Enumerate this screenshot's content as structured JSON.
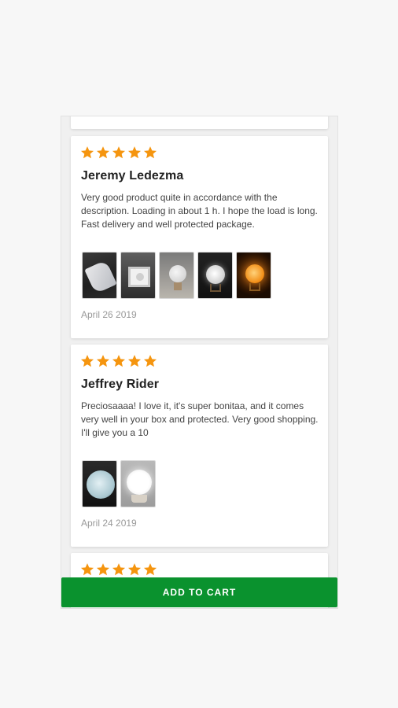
{
  "colors": {
    "star": "#f5950f",
    "cart_button": "#0a922e"
  },
  "reviews": [
    {
      "rating": 5,
      "name": "Jeremy Ledezma",
      "text": "Very good product quite in accordance with the description. Loading in about 1 h. I hope the load is long. Fast delivery and well protected package.",
      "date": "April 26 2019",
      "photos": [
        "wrapped-lamp-photo",
        "lamp-in-box-photo",
        "lamp-unlit-photo",
        "lamp-white-glow-photo",
        "lamp-orange-glow-photo"
      ]
    },
    {
      "rating": 5,
      "name": "Jeffrey Rider",
      "text": "Preciosaaaa! I love it, it's super bonitaa, and it comes very well in your box and protected. Very good shopping. I'll give you a 10",
      "date": "April 24 2019",
      "photos": [
        "moon-lamp-blue-photo",
        "moon-lamp-bright-photo"
      ]
    },
    {
      "rating": 5
    }
  ],
  "cart": {
    "label": "ADD TO CART"
  }
}
